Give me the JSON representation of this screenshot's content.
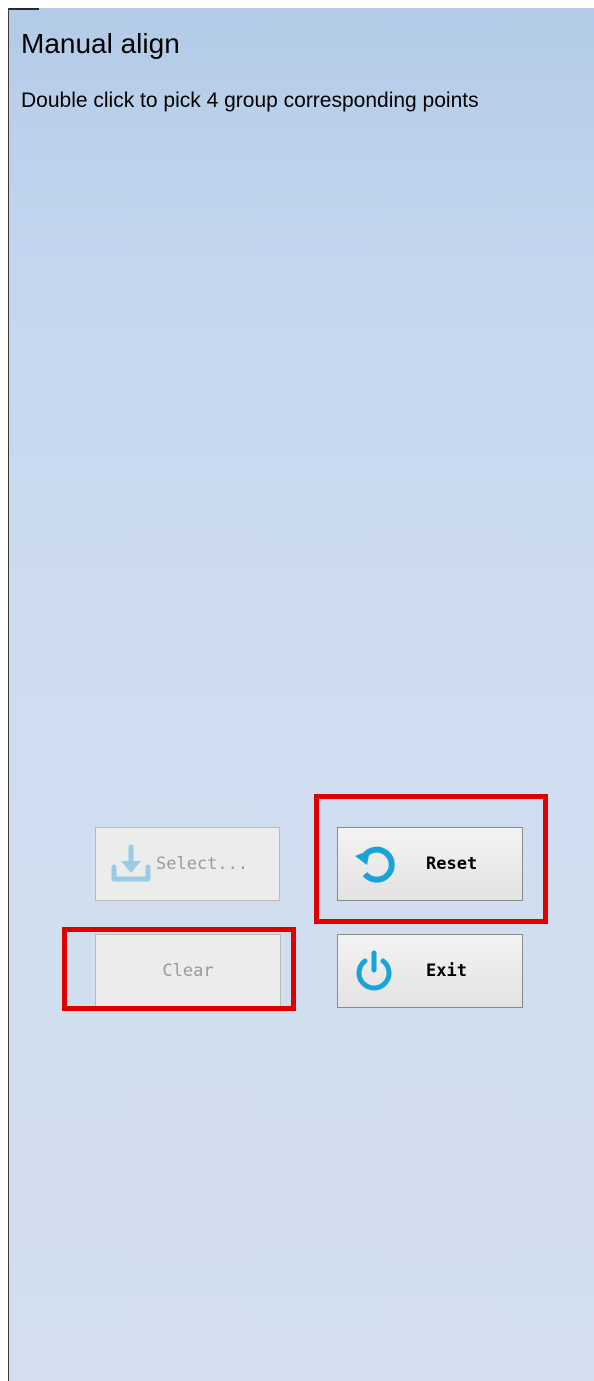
{
  "panel": {
    "title": "Manual align",
    "instruction": "Double click to pick 4 group corresponding points"
  },
  "buttons": {
    "select": {
      "label": "Select...",
      "icon": "download-icon",
      "enabled": false
    },
    "reset": {
      "label": "Reset",
      "icon": "reset-icon",
      "enabled": true
    },
    "clear": {
      "label": "Clear",
      "enabled": false
    },
    "exit": {
      "label": "Exit",
      "icon": "power-icon",
      "enabled": true
    }
  },
  "highlights": [
    "reset",
    "clear"
  ],
  "colors": {
    "panel_top": "#b3cbe8",
    "panel_bottom": "#d3dff0",
    "icon_blue": "#1aa3d8",
    "highlight_red": "#e00000"
  }
}
